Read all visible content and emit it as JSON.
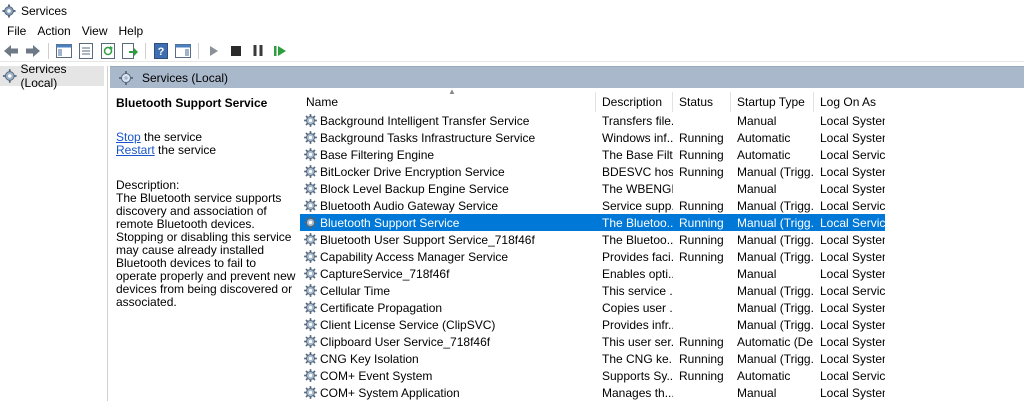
{
  "window": {
    "title": "Services"
  },
  "menu": {
    "items": [
      "File",
      "Action",
      "View",
      "Help"
    ]
  },
  "toolbar": {
    "buttons": [
      "back-icon",
      "forward-icon",
      "show-hide-console-tree-icon",
      "properties-icon",
      "refresh-icon",
      "export-list-icon",
      "help-icon",
      "show-hide-action-pane-icon",
      "start-service-icon",
      "stop-service-icon",
      "pause-service-icon",
      "resume-service-icon"
    ]
  },
  "tree": {
    "root_label": "Services (Local)"
  },
  "content": {
    "header_title": "Services (Local)"
  },
  "details": {
    "title": "Bluetooth Support Service",
    "stop_link": "Stop",
    "stop_suffix": " the service",
    "restart_link": "Restart",
    "restart_suffix": " the service",
    "description_label": "Description:",
    "description_text": "The Bluetooth service supports discovery and association of remote Bluetooth devices.  Stopping or disabling this service may cause already installed Bluetooth devices to fail to operate properly and prevent new devices from being discovered or associated."
  },
  "table": {
    "columns": [
      "Name",
      "Description",
      "Status",
      "Startup Type",
      "Log On As"
    ],
    "rows": [
      [
        "Background Intelligent Transfer Service",
        "Transfers file...",
        "",
        "Manual",
        "Local System"
      ],
      [
        "Background Tasks Infrastructure Service",
        "Windows inf...",
        "Running",
        "Automatic",
        "Local System"
      ],
      [
        "Base Filtering Engine",
        "The Base Filt...",
        "Running",
        "Automatic",
        "Local Service"
      ],
      [
        "BitLocker Drive Encryption Service",
        "BDESVC hos...",
        "Running",
        "Manual (Trigg...",
        "Local System"
      ],
      [
        "Block Level Backup Engine Service",
        "The WBENGI...",
        "",
        "Manual",
        "Local System"
      ],
      [
        "Bluetooth Audio Gateway Service",
        "Service supp...",
        "Running",
        "Manual (Trigg...",
        "Local Service"
      ],
      [
        "Bluetooth Support Service",
        "The Bluetoo...",
        "Running",
        "Manual (Trigg...",
        "Local Service"
      ],
      [
        "Bluetooth User Support Service_718f46f",
        "The Bluetoo...",
        "Running",
        "Manual (Trigg...",
        "Local System"
      ],
      [
        "Capability Access Manager Service",
        "Provides faci...",
        "Running",
        "Manual (Trigg...",
        "Local System"
      ],
      [
        "CaptureService_718f46f",
        "Enables opti...",
        "",
        "Manual",
        "Local System"
      ],
      [
        "Cellular Time",
        "This service ...",
        "",
        "Manual (Trigg...",
        "Local Service"
      ],
      [
        "Certificate Propagation",
        "Copies user ...",
        "",
        "Manual (Trigg...",
        "Local System"
      ],
      [
        "Client License Service (ClipSVC)",
        "Provides infr...",
        "",
        "Manual (Trigg...",
        "Local System"
      ],
      [
        "Clipboard User Service_718f46f",
        "This user ser...",
        "Running",
        "Automatic (De...",
        "Local System"
      ],
      [
        "CNG Key Isolation",
        "The CNG ke...",
        "Running",
        "Manual (Trigg...",
        "Local System"
      ],
      [
        "COM+ Event System",
        "Supports Sy...",
        "Running",
        "Automatic",
        "Local Service"
      ],
      [
        "COM+ System Application",
        "Manages th...",
        "",
        "Manual",
        "Local System"
      ]
    ],
    "selected_index": 6
  },
  "colors": {
    "selection": "#0078d7",
    "header_band": "#aab8cc",
    "link": "#1a56c9"
  }
}
